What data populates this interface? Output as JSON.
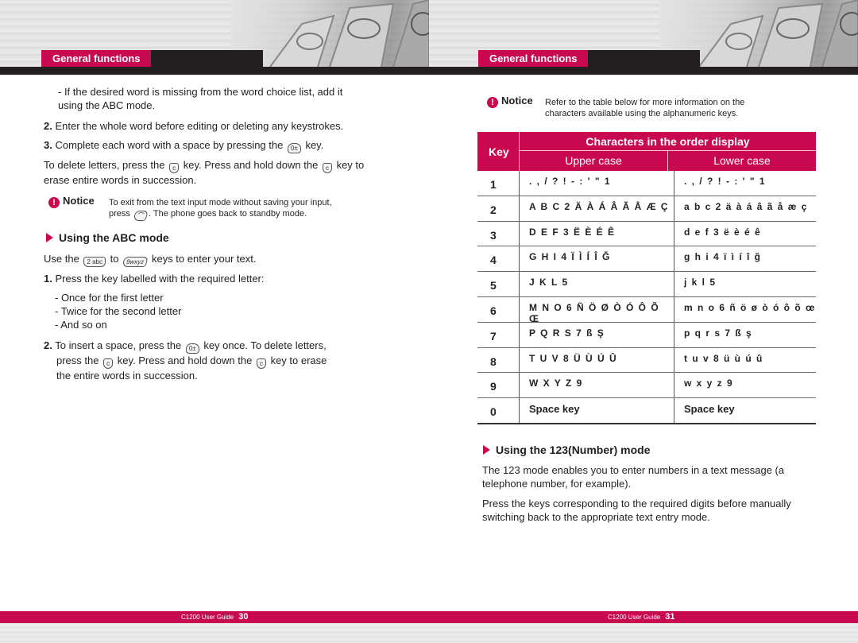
{
  "left_page": {
    "header_tab": "General functions",
    "bullet_missing_word": "- If the desired word is missing from the word choice list, add it using the ABC mode.",
    "step2_num": "2.",
    "step2_text": "Enter the whole word before editing or deleting any keystrokes.",
    "step3_num": "3.",
    "step3_pre": "Complete each word with a space by pressing the",
    "step3_post": "key.",
    "delete_pre": "To delete letters, press the",
    "delete_mid": "key. Press and hold down the",
    "delete_post": "key to erase entire words in succession.",
    "notice": {
      "label": "Notice",
      "line1": "To exit from the text input mode without saving your input,",
      "line2_pre": "press",
      "line2_post": ". The phone goes back to standby mode."
    },
    "abc_section_title": "Using the ABC mode",
    "use_pre": "Use the",
    "use_mid": "to",
    "use_post": "keys to enter your text.",
    "abc_step1_num": "1.",
    "abc_step1_text": "Press the key labelled with the required letter:",
    "abc_sub": [
      "- Once for the first letter",
      "- Twice for the second letter",
      "- And so on"
    ],
    "abc_step2_num": "2.",
    "abc_step2_a": "To insert a space, press the",
    "abc_step2_b": "key once. To delete letters,",
    "abc_step2_c": "press the",
    "abc_step2_d": "key. Press and hold down the",
    "abc_step2_e": "key to erase",
    "abc_step2_f": "the entire words in succession.",
    "footer_guide": "C1200 User Guide",
    "footer_page": "30"
  },
  "right_page": {
    "header_tab": "General functions",
    "notice": {
      "label": "Notice",
      "line1": "Refer to the table below for more information on the",
      "line2": "characters available using the alphanumeric keys."
    },
    "table": {
      "col_key": "Key",
      "col_chars": "Characters in the order display",
      "col_upper": "Upper case",
      "col_lower": "Lower case",
      "rows": [
        {
          "key": "1",
          "upper": ". , / ? ! - : ' \" 1",
          "lower": ". , / ? ! - : ' \" 1"
        },
        {
          "key": "2",
          "upper": "A B C 2 Ä À Á Â Ã Å Æ Ç",
          "lower": "a b c 2 ä à á â ã å æ ç"
        },
        {
          "key": "3",
          "upper": "D E F 3 Ë È É Ê",
          "lower": "d e f 3 ë è é ê"
        },
        {
          "key": "4",
          "upper": "G H I 4 Ï Ì Í Î Ğ",
          "lower": "g h i 4 ï ì í î ğ"
        },
        {
          "key": "5",
          "upper": "J K L 5",
          "lower": "j k l 5"
        },
        {
          "key": "6",
          "upper": "M N O 6 Ñ Ö Ø Ò Ó Ô Õ Œ",
          "lower": "m n o 6 ñ ö ø ò ó ô õ œ"
        },
        {
          "key": "7",
          "upper": "P Q R S 7 ß Ş",
          "lower": "p q r s 7 ß ş"
        },
        {
          "key": "8",
          "upper": "T U V 8 Ü Ù Ú Û",
          "lower": "t u v 8 ü ù ú û"
        },
        {
          "key": "9",
          "upper": "W X Y Z 9",
          "lower": "w x y z 9"
        },
        {
          "key": "0",
          "upper": "Space key",
          "lower": "Space key"
        }
      ]
    },
    "number_section_title": "Using the 123(Number) mode",
    "number_p1": "The 123 mode enables you to enter numbers in a text message (a telephone number, for example).",
    "number_p2": "Press the keys corresponding to the required digits before manually switching back to the appropriate text entry mode.",
    "footer_guide": "C1200 User Guide",
    "footer_page": "31"
  },
  "keys": {
    "zero": "0±",
    "clear": "c",
    "two": "2 abc",
    "nine": "9wxyz",
    "end": "⌒"
  },
  "colors": {
    "accent": "#c8084f",
    "header_black": "#231f20"
  }
}
